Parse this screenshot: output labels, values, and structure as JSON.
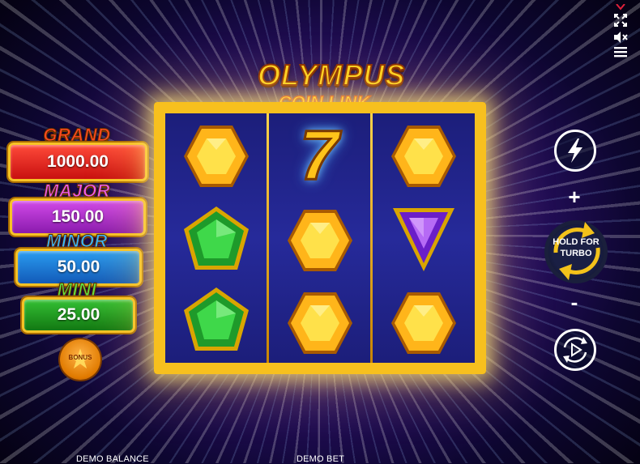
{
  "game": {
    "logo_line1": "OLYMPUS",
    "logo_line2": "COIN LINK"
  },
  "jackpots": [
    {
      "name": "GRAND",
      "value": "1000.00",
      "title_color": "#ff3a1a",
      "box_color": "#e21c1c"
    },
    {
      "name": "MAJOR",
      "value": "150.00",
      "title_color": "#e64ce8",
      "box_color": "#b12ad0"
    },
    {
      "name": "MINOR",
      "value": "50.00",
      "title_color": "#2fb0ff",
      "box_color": "#1a7ad8"
    },
    {
      "name": "MINI",
      "value": "25.00",
      "title_color": "#5fe03a",
      "box_color": "#1c9a1c"
    }
  ],
  "bonus_button": {
    "label": "BONUS",
    "icon": "star-icon"
  },
  "reels": [
    [
      "yellow-gem",
      "green-gem",
      "green-gem"
    ],
    [
      "seven",
      "yellow-gem",
      "yellow-gem"
    ],
    [
      "yellow-gem",
      "purple-gem",
      "yellow-gem"
    ]
  ],
  "symbols": {
    "seven_label": "7"
  },
  "controls": {
    "turbo_icon": "lightning-icon",
    "bet_plus": "+",
    "bet_minus": "-",
    "hold_for_turbo_line1": "HOLD FOR",
    "hold_for_turbo_line2": "TURBO",
    "autoplay_icon": "autoplay-icon"
  },
  "top_icons": [
    "fullscreen-icon",
    "sound-muted-icon",
    "menu-icon"
  ],
  "footer": {
    "balance_label": "DEMO BALANCE",
    "bet_label": "DEMO BET"
  },
  "colors": {
    "frame_gold": "#f7c01e",
    "reel_bg": "#1c1e7a",
    "gem_yellow": "#ffc21a",
    "gem_green": "#2fc83a",
    "gem_purple": "#7a2ad8"
  }
}
